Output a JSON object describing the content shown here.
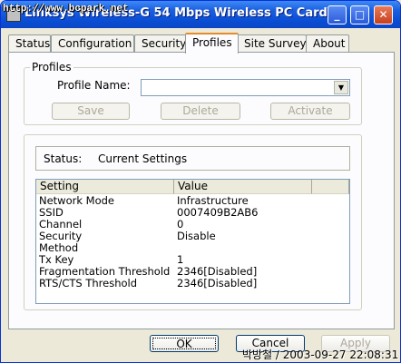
{
  "window": {
    "title": "Linksys Wireless-G 54 Mbps Wireless PC Card",
    "watermark": "http://www.bcpark.net",
    "controls": {
      "minimize": "_",
      "maximize": "□",
      "close": "✕"
    }
  },
  "tabs": [
    {
      "label": "Status"
    },
    {
      "label": "Configuration"
    },
    {
      "label": "Security"
    },
    {
      "label": "Profiles"
    },
    {
      "label": "Site Survey"
    },
    {
      "label": "About"
    }
  ],
  "profiles": {
    "group_title": "Profiles",
    "profile_name_label": "Profile Name:",
    "profile_name_value": "",
    "buttons": {
      "save": "Save",
      "delete": "Delete",
      "activate": "Activate"
    }
  },
  "status": {
    "label": "Status:",
    "value": "Current Settings"
  },
  "table": {
    "columns": [
      "Setting",
      "Value"
    ],
    "rows": [
      {
        "setting": "Network Mode",
        "value": "Infrastructure"
      },
      {
        "setting": "SSID",
        "value": "0007409B2AB6"
      },
      {
        "setting": "Channel",
        "value": "0"
      },
      {
        "setting": "Security",
        "value": "Disable"
      },
      {
        "setting": "Method",
        "value": ""
      },
      {
        "setting": "Tx Key",
        "value": "1"
      },
      {
        "setting": "Fragmentation Threshold",
        "value": "2346[Disabled]"
      },
      {
        "setting": "RTS/CTS Threshold",
        "value": "2346[Disabled]"
      }
    ]
  },
  "footer": {
    "ok": "OK",
    "cancel": "Cancel",
    "apply": "Apply"
  },
  "caption": "박방철 / 2003-09-27 22:08:31"
}
